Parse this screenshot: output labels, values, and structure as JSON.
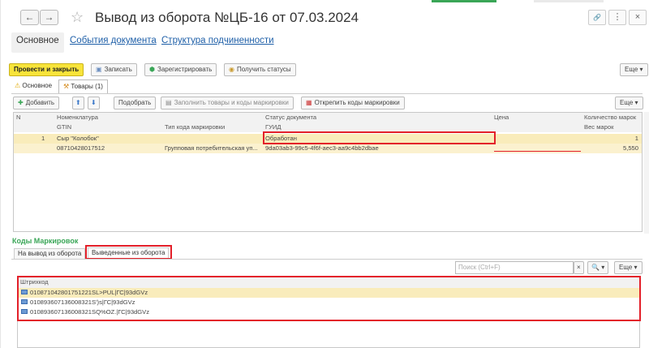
{
  "window": {
    "title": "Вывод из оборота №ЦБ-16 от 07.03.2024",
    "back_glyph": "←",
    "forward_glyph": "→",
    "star_glyph": "☆",
    "link_glyph": "🔗",
    "more_glyph": "⋮",
    "close_glyph": "×"
  },
  "section_tabs": {
    "main": "Основное",
    "events": "События документа",
    "structure": "Структура подчиненности"
  },
  "toolbar": {
    "post_close": "Провести и закрыть",
    "save": "Записать",
    "register": "Зарегистрировать",
    "get_status": "Получить статусы",
    "more": "Еще"
  },
  "inner_tabs": {
    "main": "Основное",
    "goods": "Товары (1)"
  },
  "goods_toolbar": {
    "add": "Добавить",
    "pick": "Подобрать",
    "fill": "Заполнить товары и коды маркировки",
    "detach": "Открепить коды маркировки",
    "more": "Еще"
  },
  "goods_table": {
    "headers_row1": [
      "N",
      "Номенклатура",
      "Статус документа",
      "Цена",
      "Количество марок"
    ],
    "headers_row2": [
      "GTIN",
      "Тип кода маркировки",
      "ГУИД",
      "Вес марок"
    ],
    "rows": [
      {
        "n": "1",
        "nomenclature": "Сыр \"Колобок\"",
        "status": "Обработан",
        "price": "",
        "qty": "1",
        "gtin": "08710428017512",
        "code_type": "Групповая потребительская уп...",
        "guid": "9da03ab3-99c5-4f6f-aec3-aa9c4bb2dbae",
        "weight": "5,550"
      }
    ]
  },
  "codes": {
    "title": "Коды Маркировок",
    "tab_to_withdraw": "На вывод из оборота",
    "tab_withdrawn": "Выведенные из оборота",
    "search_placeholder": "Поиск (Ctrl+F)",
    "more": "Еще",
    "header": "Штрихкод",
    "rows": [
      "010871042801751221SL>PUL|ГС|93dGVz",
      "010893607136008321S')s|ГС|93dGVz",
      "010893607136008321SQ%OZ.|ГС|93dGVz"
    ]
  },
  "colors": {
    "accent_green": "#3aa657",
    "link_blue": "#1e5fa8",
    "highlight_red": "#e3202a",
    "primary_yellow": "#f8e43a",
    "row_selected": "#f9ecbb"
  }
}
